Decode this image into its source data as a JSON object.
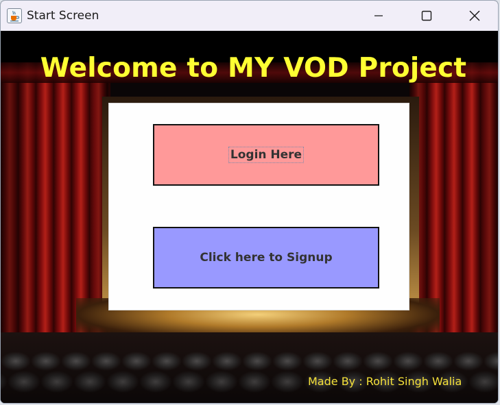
{
  "window": {
    "title": "Start Screen",
    "icon": "java-cup-icon",
    "controls": {
      "minimize": "minimize-icon",
      "maximize": "maximize-icon",
      "close": "close-icon"
    }
  },
  "main": {
    "heading": "Welcome to MY VOD Project",
    "login_label": "Login Here",
    "signup_label": "Click here to Signup",
    "credit": "Made By : Rohit Singh Walia"
  },
  "colors": {
    "heading": "#ffff33",
    "login_button": "#ff9999",
    "signup_button": "#9999ff",
    "credit": "#f5e13a",
    "screen": "#fefefe"
  }
}
